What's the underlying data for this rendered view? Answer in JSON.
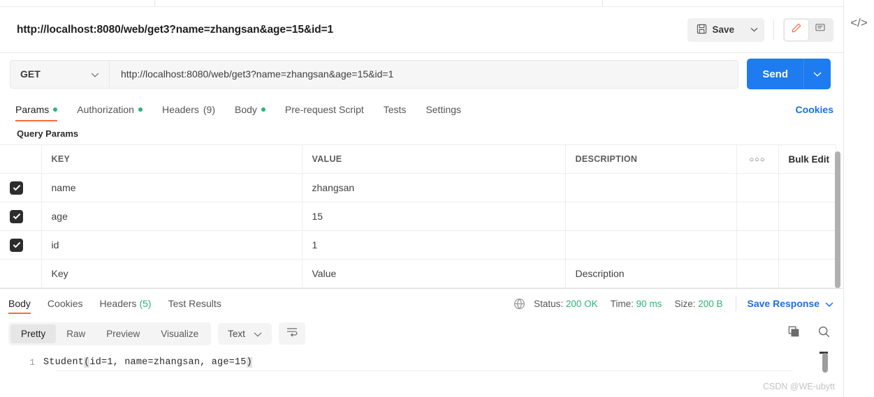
{
  "window": {
    "request_title": "http://localhost:8080/web/get3?name=zhangsan&age=15&id=1"
  },
  "toolbar": {
    "save_label": "Save",
    "save_caret": "⌄",
    "edit_icon": "pencil-icon",
    "comment_icon": "comment-icon",
    "code_icon": "</>"
  },
  "url_bar": {
    "method": "GET",
    "method_caret": "⌄",
    "url": "http://localhost:8080/web/get3?name=zhangsan&age=15&id=1",
    "send_label": "Send",
    "send_caret": "⌄"
  },
  "request_tabs": {
    "items": [
      {
        "label": "Params",
        "dot": true,
        "count": "",
        "active": true
      },
      {
        "label": "Authorization",
        "dot": true,
        "count": "",
        "active": false
      },
      {
        "label": "Headers",
        "dot": false,
        "count": "(9)",
        "active": false
      },
      {
        "label": "Body",
        "dot": true,
        "count": "",
        "active": false
      },
      {
        "label": "Pre-request Script",
        "dot": false,
        "count": "",
        "active": false
      },
      {
        "label": "Tests",
        "dot": false,
        "count": "",
        "active": false
      },
      {
        "label": "Settings",
        "dot": false,
        "count": "",
        "active": false
      }
    ],
    "cookies_link": "Cookies"
  },
  "query_params": {
    "section_label": "Query Params",
    "headers": {
      "key": "KEY",
      "value": "VALUE",
      "description": "DESCRIPTION",
      "more": "○○○",
      "bulk_edit": "Bulk Edit"
    },
    "rows": [
      {
        "checked": true,
        "key": "name",
        "value": "zhangsan",
        "description": ""
      },
      {
        "checked": true,
        "key": "age",
        "value": "15",
        "description": ""
      },
      {
        "checked": true,
        "key": "id",
        "value": "1",
        "description": ""
      }
    ],
    "placeholder_row": {
      "key": "Key",
      "value": "Value",
      "description": "Description"
    }
  },
  "response": {
    "tabs": [
      {
        "label": "Body",
        "count": "",
        "active": true
      },
      {
        "label": "Cookies",
        "count": "",
        "active": false
      },
      {
        "label": "Headers",
        "count": "(5)",
        "active": false
      },
      {
        "label": "Test Results",
        "count": "",
        "active": false
      }
    ],
    "status_label": "Status:",
    "status_value": "200 OK",
    "time_label": "Time:",
    "time_value": "90 ms",
    "size_label": "Size:",
    "size_value": "200 B",
    "save_response": "Save Response",
    "save_response_caret": "⌄",
    "view_modes": [
      {
        "label": "Pretty",
        "active": true
      },
      {
        "label": "Raw",
        "active": false
      },
      {
        "label": "Preview",
        "active": false
      },
      {
        "label": "Visualize",
        "active": false
      }
    ],
    "format": "Text",
    "format_caret": "⌄",
    "body": {
      "line_number": "1",
      "prefix": "Student",
      "open_paren": "(",
      "inner": "id=1, name=zhangsan, age=15",
      "close_paren": ")"
    }
  },
  "watermark": "CSDN @WE-ubytt",
  "colors": {
    "accent": "#ff6c37",
    "send_blue": "#1e7bf0",
    "link_blue": "#1c6fe0",
    "status_green": "#2bb673"
  }
}
